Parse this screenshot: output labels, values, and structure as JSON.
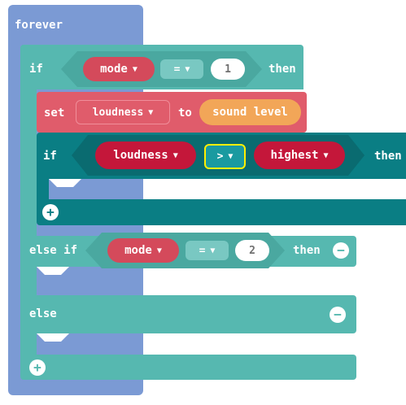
{
  "forever": {
    "label": "forever"
  },
  "if_block": {
    "if_label": "if",
    "then_label": "then",
    "condition": {
      "left_var": "mode",
      "operator": "=",
      "right_value": "1"
    }
  },
  "set_block": {
    "set_label": "set",
    "variable": "loudness",
    "to_label": "to",
    "value": "sound level"
  },
  "inner_if": {
    "if_label": "if",
    "then_label": "then",
    "condition": {
      "left_var": "loudness",
      "operator": ">",
      "right_var": "highest"
    }
  },
  "else_if": {
    "label": "else if",
    "then_label": "then",
    "condition": {
      "left_var": "mode",
      "operator": "=",
      "right_value": "2"
    }
  },
  "else_block": {
    "label": "else"
  },
  "icons": {
    "add": "+",
    "remove": "−",
    "caret": "▼"
  },
  "colors": {
    "basic": "#7b9ad4",
    "logic": "#56b8b0",
    "logic_dark": "#0a7e84",
    "variables": "#e05c6b",
    "input": "#f2a658",
    "highlight": "#ffef00"
  }
}
